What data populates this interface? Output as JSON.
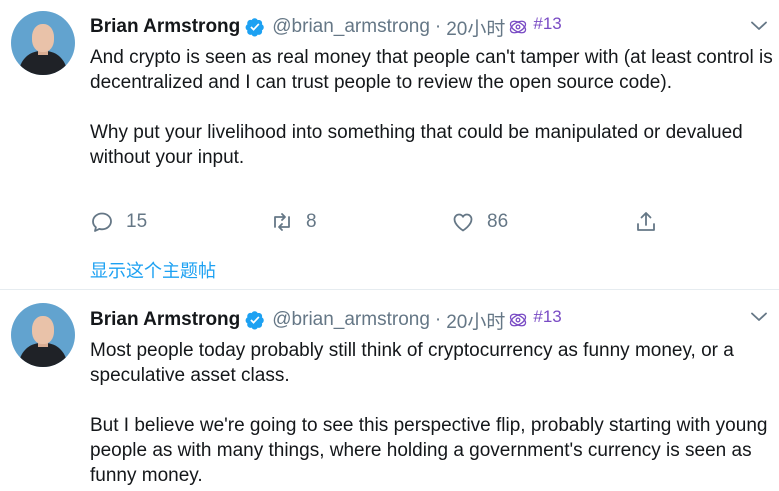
{
  "tweets": [
    {
      "name": "Brian Armstrong",
      "handle": "@brian_armstrong",
      "separator": "·",
      "time": "20小时",
      "tag": "#13",
      "text": "And crypto is seen as real money that people can't tamper with (at least control is decentralized and I can trust people to review the open source code).\n\nWhy put your livelihood into something that could be manipulated or devalued without your input.",
      "replies": "15",
      "retweets": "8",
      "likes": "86",
      "show_thread": "显示这个主题帖"
    },
    {
      "name": "Brian Armstrong",
      "handle": "@brian_armstrong",
      "separator": "·",
      "time": "20小时",
      "tag": "#13",
      "text": "Most people today probably still think of cryptocurrency as funny money, or a speculative asset class.\n\nBut I believe we're going to see this perspective flip, probably starting with young people as with many things, where holding a government's currency is seen as funny money."
    }
  ],
  "colors": {
    "text": "#14171a",
    "secondary": "#657786",
    "link": "#1da1f2",
    "verified": "#1da1f2",
    "tag": "#794bc4",
    "divider": "#e6ecf0"
  },
  "icons": [
    "verified-badge-icon",
    "cycle-icon",
    "chevron-down-icon",
    "reply-icon",
    "retweet-icon",
    "like-icon",
    "share-icon"
  ]
}
